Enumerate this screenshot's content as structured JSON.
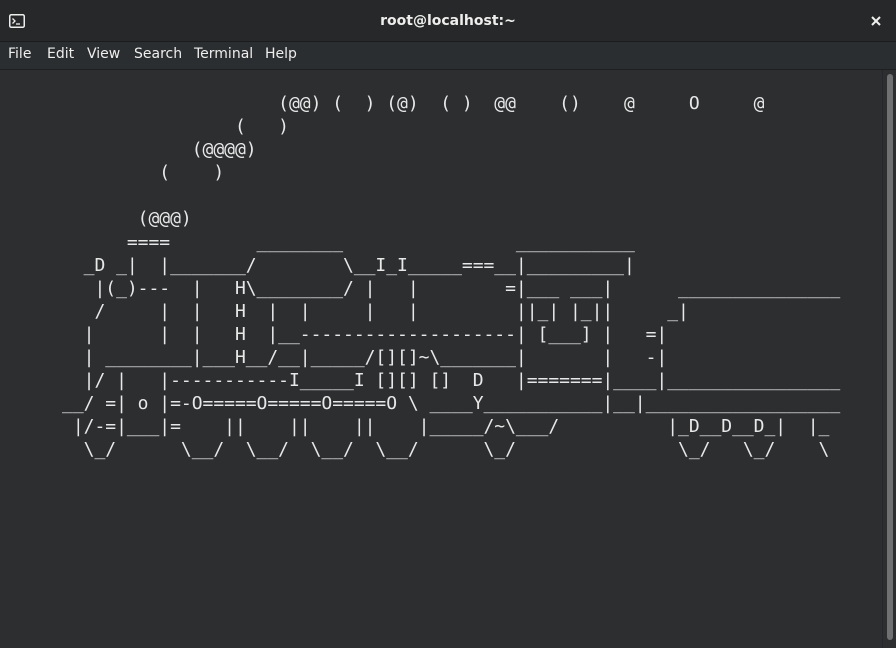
{
  "window": {
    "title": "root@localhost:~"
  },
  "icons": {
    "app": "terminal-icon",
    "close": "close-icon"
  },
  "menu": {
    "items": [
      {
        "label": "File"
      },
      {
        "label": "Edit"
      },
      {
        "label": "View"
      },
      {
        "label": "Search"
      },
      {
        "label": "Terminal"
      },
      {
        "label": "Help"
      }
    ]
  },
  "terminal": {
    "screen_text": "                         (@@) (  ) (@)  ( )  @@    ()    @     O     @\n                     (   )\n                 (@@@@)\n              (    )\n\n            (@@@)\n           ====        ________                ___________\n       _D _|  |_______/        \\__I_I_____===__|_________|\n        |(_)---  |   H\\________/ |   |        =|___ ___|      _______________\n        /     |  |   H  |  |     |   |         ||_| |_||     _|\n       |      |  |   H  |__--------------------| [___] |   =|\n       | ________|___H__/__|_____/[][]~\\_______|       |   -|\n       |/ |   |-----------I_____I [][] []  D   |=======|____|________________\n     __/ =| o |=-O=====O=====O=====O \\ ____Y___________|__|__________________\n      |/-=|___|=    ||    ||    ||    |_____/~\\___/          |_D__D__D_|  |_\n       \\_/      \\__/  \\__/  \\__/  \\__/      \\_/               \\_/   \\_/    \\"
  },
  "colors": {
    "background": "#2c2e30",
    "foreground": "#e8e8e8",
    "titlebar": "#262829"
  }
}
